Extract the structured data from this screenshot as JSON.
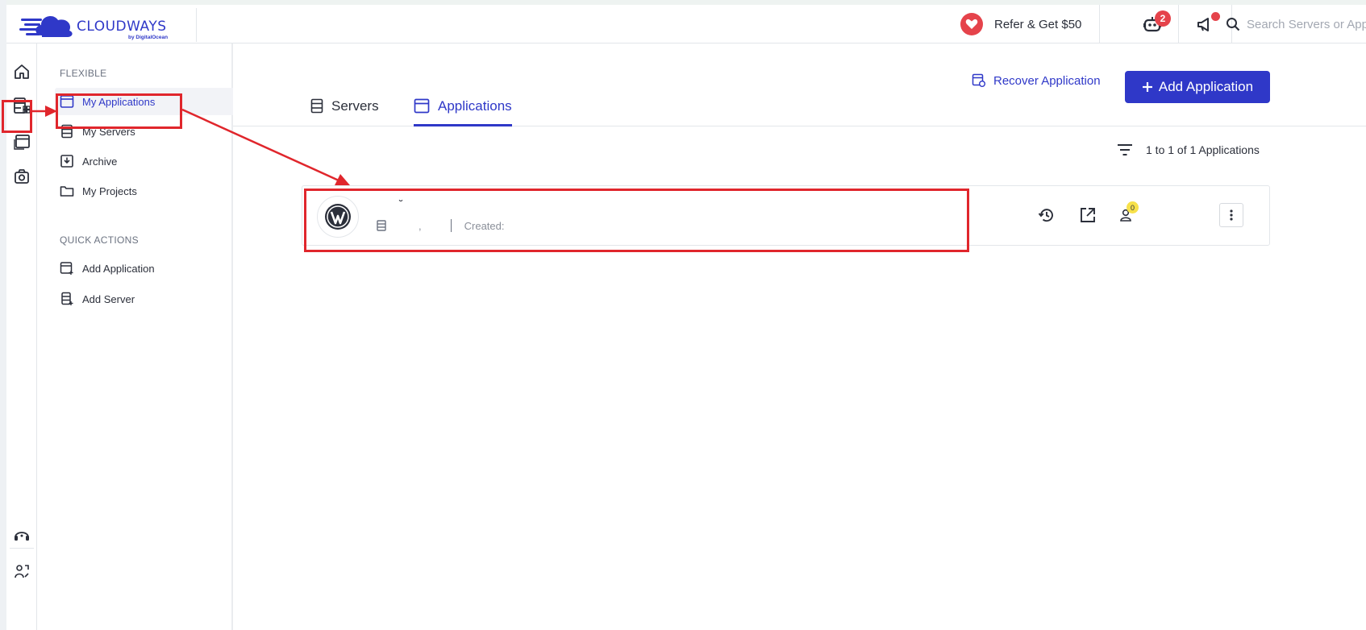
{
  "header": {
    "brand": "CLOUDWAYS",
    "brand_sub": "by DigitalOcean",
    "refer_label": "Refer & Get $50",
    "bot_badge": "2",
    "search_placeholder": "Search Servers or Apps"
  },
  "sidebar": {
    "section1": "FLEXIBLE",
    "items": [
      {
        "label": "My Applications",
        "icon": "app-window-icon"
      },
      {
        "label": "My Servers",
        "icon": "server-icon"
      },
      {
        "label": "Archive",
        "icon": "archive-icon"
      },
      {
        "label": "My Projects",
        "icon": "folder-icon"
      }
    ],
    "section2": "QUICK ACTIONS",
    "quick": [
      {
        "label": "Add Application",
        "icon": "add-app-icon"
      },
      {
        "label": "Add Server",
        "icon": "add-server-icon"
      }
    ]
  },
  "main": {
    "recover_label": "Recover Application",
    "add_label": "Add Application",
    "tabs": [
      {
        "label": "Servers"
      },
      {
        "label": "Applications"
      }
    ],
    "count_label": "1 to 1 of 1 Applications",
    "app": {
      "name": "˘",
      "server": ",",
      "created_label": "Created:",
      "collab_badge": "0"
    }
  },
  "colors": {
    "accent": "#2f38c8",
    "annotation": "#e0262c",
    "alert": "#e5434b"
  }
}
